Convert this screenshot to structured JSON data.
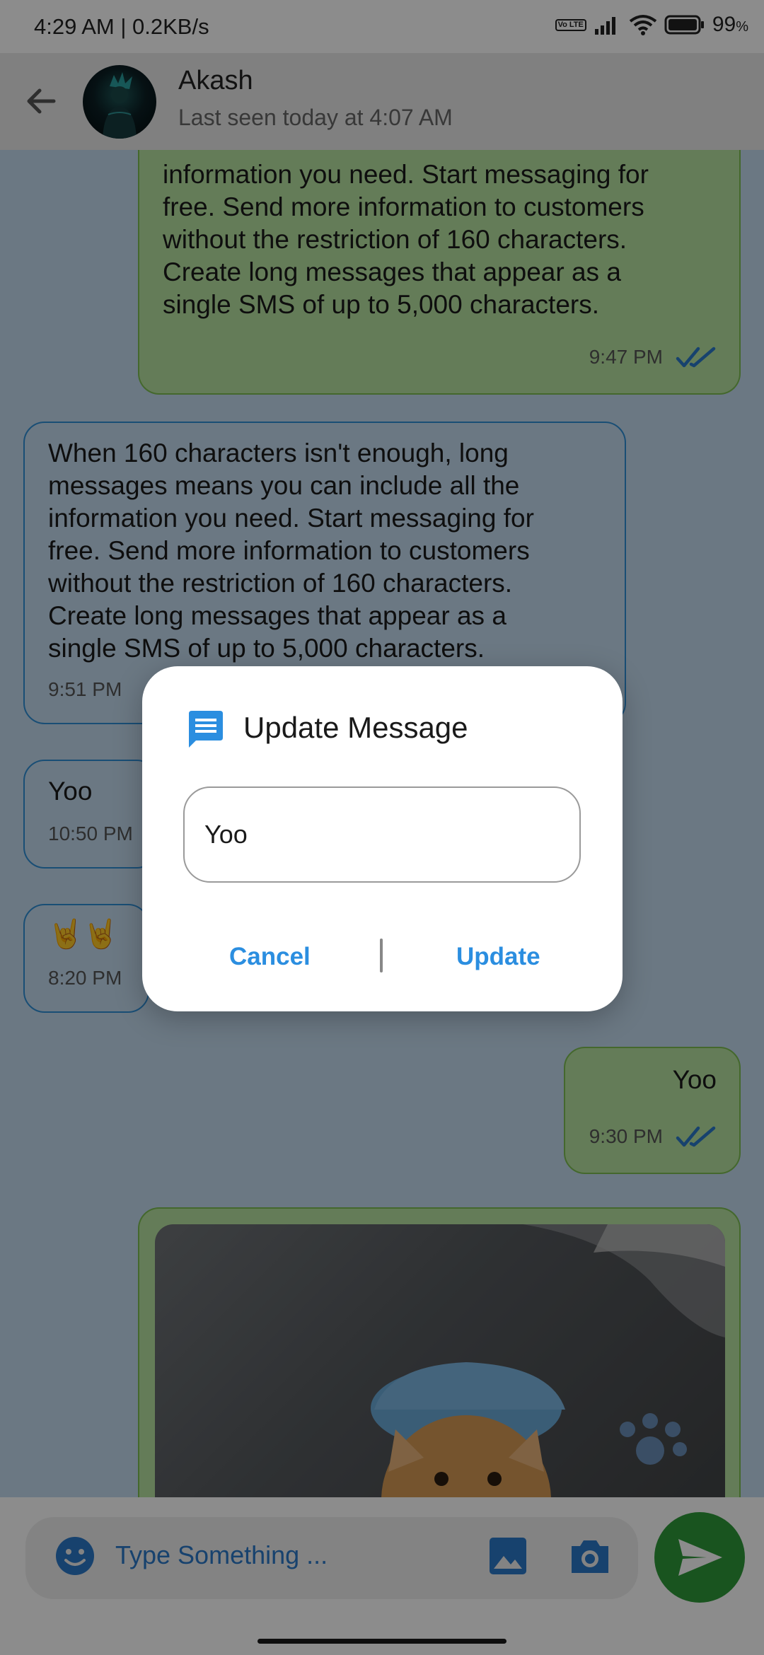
{
  "status_bar": {
    "time_speed": "4:29 AM | 0.2KB/s",
    "volte_badge": "Vo LTE",
    "battery": "99",
    "battery_unit": "%"
  },
  "header": {
    "contact_name": "Akash",
    "last_seen": "Last seen today at 4:07 AM",
    "back_icon": "arrow-back-icon"
  },
  "messages": [
    {
      "direction": "outgoing",
      "lines": [
        "information you need. Start messaging for",
        "free. Send more information to customers",
        "without the restriction of 160 characters.",
        "Create long messages that appear as a",
        "single SMS of up to 5,000 characters."
      ],
      "time": "9:47 PM",
      "read": true
    },
    {
      "direction": "incoming",
      "lines": [
        "When 160 characters isn't enough, long",
        "messages means you can include all the",
        "information you need. Start messaging for",
        "free. Send more information to customers",
        "without the restriction of 160 characters.",
        "Create long messages that appear as a",
        "single SMS of up to 5,000 characters."
      ],
      "time": "9:51 PM"
    },
    {
      "direction": "incoming",
      "text": "Yoo",
      "time": "10:50 PM"
    },
    {
      "direction": "incoming",
      "text": "🤘🤘",
      "time": "8:20 PM"
    },
    {
      "direction": "outgoing",
      "text": "Yoo",
      "time": "9:30 PM",
      "read": true
    },
    {
      "direction": "outgoing",
      "type": "image",
      "image": "cat-with-mask-photo"
    }
  ],
  "input_bar": {
    "placeholder": "Type Something ...",
    "emoji_icon": "emoji-icon",
    "gallery_icon": "image-icon",
    "camera_icon": "camera-icon",
    "send_icon": "send-icon"
  },
  "dialog": {
    "title": "Update Message",
    "icon": "message-icon",
    "input_value": "Yoo",
    "cancel_label": "Cancel",
    "update_label": "Update"
  },
  "colors": {
    "chat_background": "#c3dbef",
    "outgoing_bubble": "#b7e2a0",
    "outgoing_border": "#7cbd52",
    "incoming_border": "#2f8ed6",
    "accent_blue": "#2b8ee0",
    "send_button": "#2e9a3a",
    "read_ticks": "#2b78c8"
  }
}
